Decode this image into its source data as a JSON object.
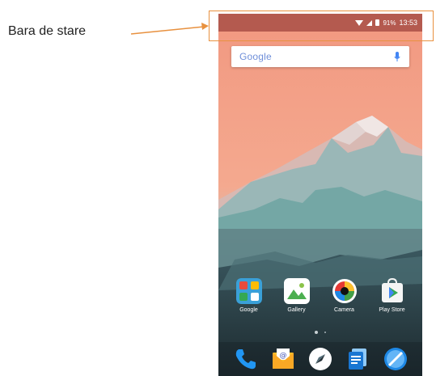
{
  "annotation": {
    "label": "Bara de stare",
    "accent": "#e8913f"
  },
  "status_bar": {
    "battery": "91%",
    "time": "13:53"
  },
  "search_bar": {
    "logo": "Google"
  },
  "apps": [
    {
      "label": "Google",
      "icon": "google-folder-icon"
    },
    {
      "label": "Gallery",
      "icon": "gallery-icon"
    },
    {
      "label": "Camera",
      "icon": "camera-icon"
    },
    {
      "label": "Play Store",
      "icon": "play-store-icon"
    }
  ],
  "dock": [
    {
      "icon": "phone-icon"
    },
    {
      "icon": "email-icon"
    },
    {
      "icon": "app-drawer-icon"
    },
    {
      "icon": "messages-icon"
    },
    {
      "icon": "browser-icon"
    }
  ]
}
